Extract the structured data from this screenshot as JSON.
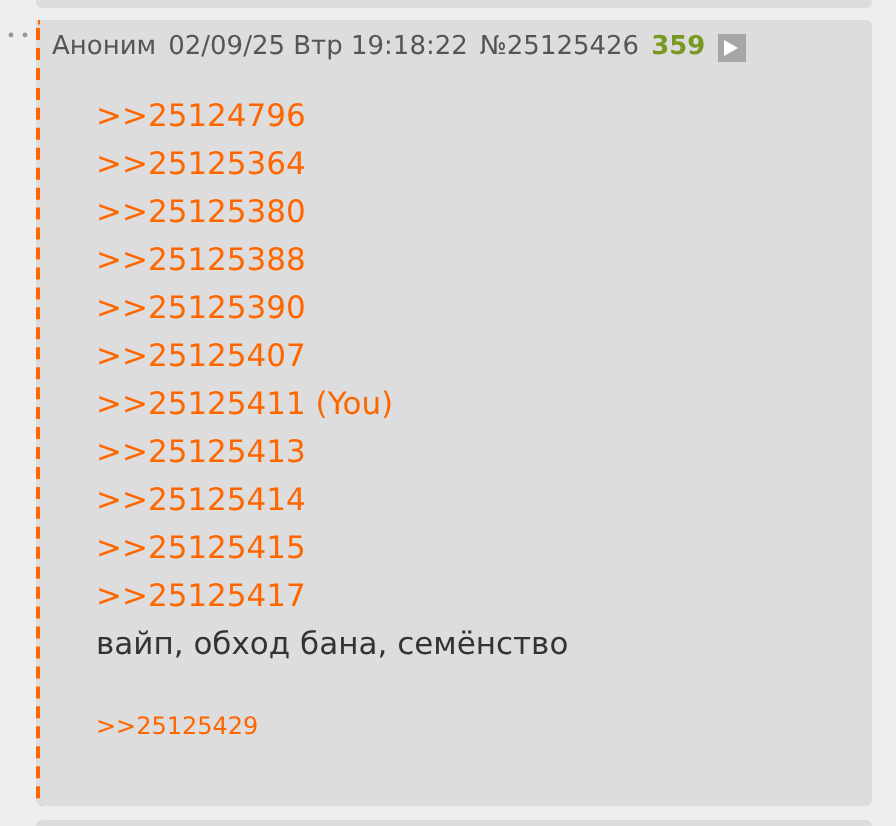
{
  "post": {
    "author": "Аноним",
    "date": "02/09/25 Втр 19:18:22",
    "number": "№25125426",
    "counter": "359",
    "quote_links": [
      ">>25124796",
      ">>25125364",
      ">>25125380",
      ">>25125388",
      ">>25125390",
      ">>25125407",
      ">>25125411 (You)",
      ">>25125413",
      ">>25125414",
      ">>25125415",
      ">>25125417"
    ],
    "message": "вайп, обход бана, семёнство",
    "replies": [
      ">>25125429"
    ]
  }
}
